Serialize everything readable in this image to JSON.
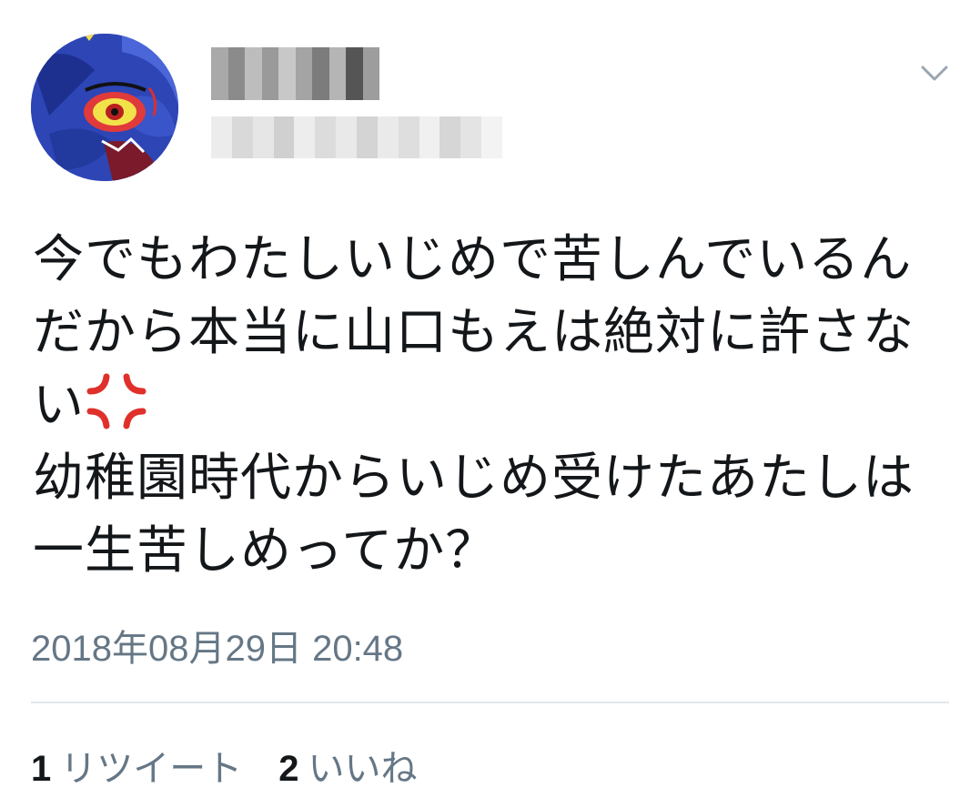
{
  "tweet": {
    "avatar_icon": "user-avatar-icon",
    "author_name": "",
    "author_handle": "",
    "text_before_emoji": "今でもわたしいじめで苦しんでいるんだから本当に山口もえは絶対に許さない",
    "emoji": "anger-symbol-icon",
    "text_after_emoji": "\n幼稚園時代からいじめ受けたあたしは一生苦しめってか？",
    "timestamp": "2018年08月29日 20:48",
    "menu_icon": "chevron-down-icon"
  },
  "stats": {
    "retweet_count": "1",
    "retweet_label": "リツイート",
    "like_count": "2",
    "like_label": "いいね"
  },
  "colors": {
    "text": "#14171a",
    "secondary_text": "#657786",
    "divider": "#e1e8ed",
    "anger_red": "#e0302b"
  }
}
